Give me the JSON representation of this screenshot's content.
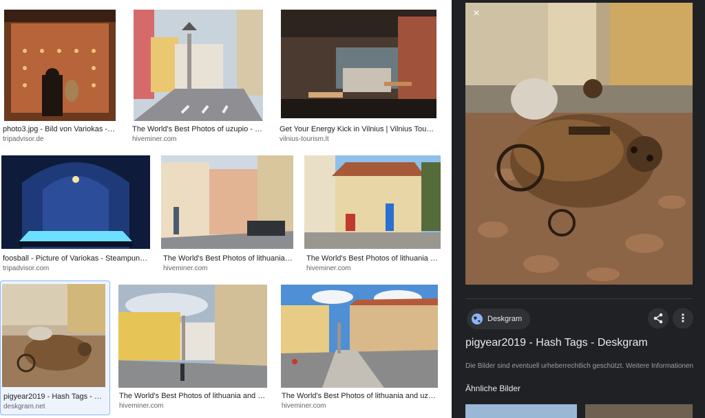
{
  "results": [
    {
      "caption": "photo3.jpg - Bild von Variokas - Ste...",
      "source": "tripadvisor.de"
    },
    {
      "caption": "The World's Best Photos of uzupio - Flic...",
      "source": "hiveminer.com"
    },
    {
      "caption": "Get Your Energy Kick in Vilnius | Vilnius Tourist ...",
      "source": "vilnius-tourism.lt"
    },
    {
      "caption": "foosball - Picture of Variokas - Steampunk b...",
      "source": "tripadvisor.com"
    },
    {
      "caption": "The World's Best Photos of lithuania an...",
      "source": "hiveminer.com"
    },
    {
      "caption": "The World's Best Photos of lithuania an...",
      "source": "hiveminer.com"
    },
    {
      "caption": "pigyear2019 - Hash Tags - Des...",
      "source": "deskgram.net"
    },
    {
      "caption": "The World's Best Photos of lithuania and uzu...",
      "source": "hiveminer.com"
    },
    {
      "caption": "The World's Best Photos of lithuania and uzupio ...",
      "source": "hiveminer.com"
    }
  ],
  "panel": {
    "close_icon": "×",
    "site_name": "Deskgram",
    "title": "pigyear2019 - Hash Tags - Deskgram",
    "notice": "Die Bilder sind eventuell urheberrechtlich geschützt.",
    "notice_link": "Weitere Informationen",
    "similar_heading": "Ähnliche Bilder",
    "share_icon": "share-icon",
    "more_icon": "⋮"
  }
}
